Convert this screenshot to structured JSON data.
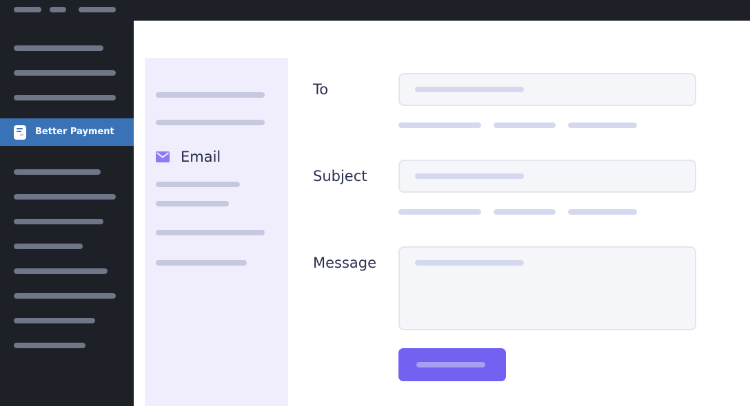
{
  "sidebar": {
    "active_item": {
      "label": "Better Payment",
      "icon": "better-payment-logo-icon"
    }
  },
  "subnav": {
    "active_item": {
      "label": "Email",
      "icon": "envelope-icon"
    }
  },
  "form": {
    "to_label": "To",
    "subject_label": "Subject",
    "message_label": "Message"
  },
  "colors": {
    "sidebar_bg": "#1d2127",
    "active_item_bg": "#3a72b6",
    "subpanel_bg": "#f0eefc",
    "submit_button_bg": "#7361f2",
    "envelope_icon": "#8b7cf5"
  }
}
